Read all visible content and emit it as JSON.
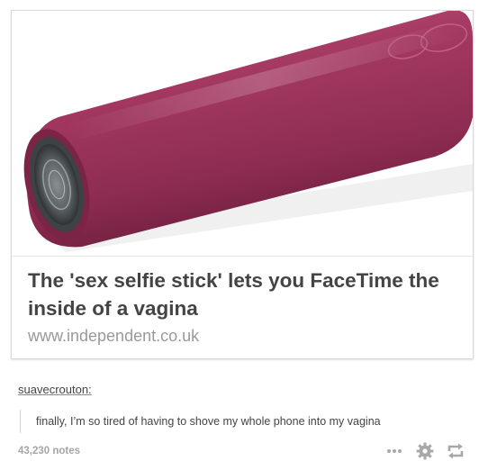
{
  "post": {
    "link": {
      "title": "The 'sex selfie stick' lets you FaceTime the inside of a vagina",
      "url": "www.independent.co.uk",
      "thumbnail_icon": "product-photo",
      "accent_color": "#a63a63"
    },
    "reblog": {
      "username": "suavecrouton:",
      "text": "finally, I’m so tired of having to shove my whole phone into my vagina"
    },
    "footer": {
      "notes": "43,230 notes",
      "actions": [
        "more-icon",
        "gear-icon",
        "reblog-icon"
      ],
      "more_glyph": "•••"
    }
  }
}
